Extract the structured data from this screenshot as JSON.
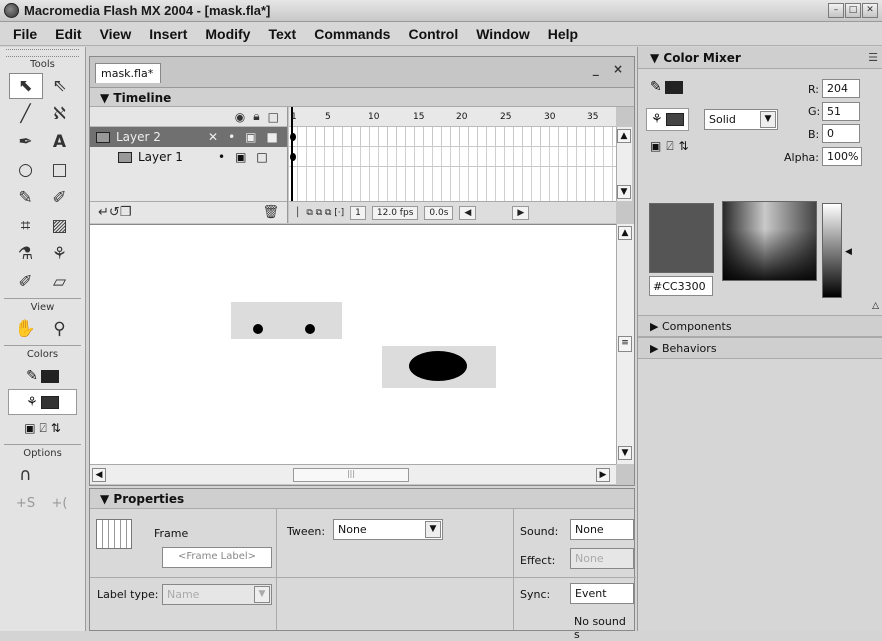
{
  "window": {
    "title": "Macromedia Flash MX 2004 - [mask.fla*]",
    "controls": [
      "–",
      "□",
      "✕"
    ]
  },
  "menu": [
    "File",
    "Edit",
    "View",
    "Insert",
    "Modify",
    "Text",
    "Commands",
    "Control",
    "Window",
    "Help"
  ],
  "tools": {
    "title": "Tools",
    "view_label": "View",
    "colors_label": "Colors",
    "options_label": "Options",
    "stroke_color": "#222222",
    "fill_color": "#333333"
  },
  "document": {
    "tab": "mask.fla*",
    "controls": "_ ×",
    "timeline_header": "Timeline",
    "layers": [
      {
        "name": "Layer 2",
        "active": true
      },
      {
        "name": "Layer 1",
        "active": false
      }
    ],
    "frame_numbers": [
      "1",
      "5",
      "10",
      "15",
      "20",
      "25",
      "30",
      "35"
    ],
    "status": {
      "current_frame": "1",
      "frame_rate": "12.0 fps",
      "elapsed": "0.0s"
    }
  },
  "properties": {
    "header": "Properties",
    "frame_label": "Frame",
    "frame_label_placeholder": "<Frame Label>",
    "label_type_label": "Label type:",
    "label_type_value": "Name",
    "tween_label": "Tween:",
    "tween_value": "None",
    "sound_label": "Sound:",
    "sound_value": "None",
    "effect_label": "Effect:",
    "effect_value": "None",
    "sync_label": "Sync:",
    "sync_value": "Event",
    "status_text": "No sound s"
  },
  "color_mixer": {
    "header": "Color Mixer",
    "fill_type": "Solid",
    "r_label": "R:",
    "r": "204",
    "g_label": "G:",
    "g": "51",
    "b_label": "B:",
    "b": "0",
    "alpha_label": "Alpha:",
    "alpha": "100%",
    "hex": "#CC3300",
    "swatch_display_color": "#555555"
  },
  "panels": {
    "components": "Components",
    "behaviors": "Behaviors"
  }
}
